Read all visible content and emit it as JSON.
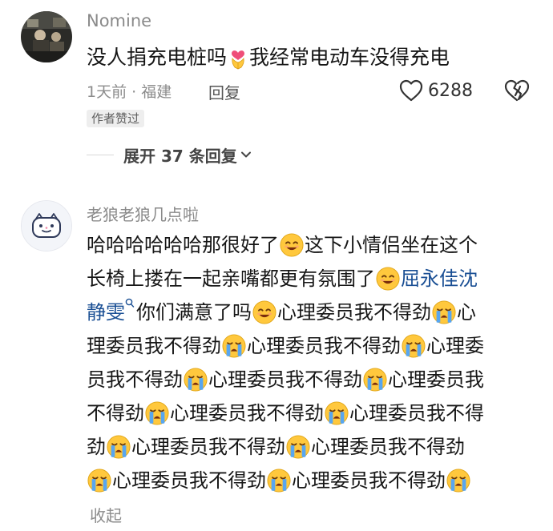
{
  "comments": [
    {
      "username": "Nomine",
      "text_before_emoji": "没人捐充电桩吗",
      "emoji": "heart-hands-emoji",
      "text_after_emoji": "我经常电动车没得充电",
      "meta": "1天前 · 福建",
      "reply_label": "回复",
      "like_count": "6288",
      "badge": "作者赞过",
      "expand_label": "展开 37 条回复"
    },
    {
      "username": "老狼老狼几点啦",
      "lines": [
        {
          "t1": "哈哈哈哈哈哈那很好了",
          "t2": "这下小情侣坐在这个"
        },
        {
          "t1": "长椅上搂在一起亲嘴都更有氛围了",
          "mention": "屈永佳沈"
        },
        {
          "mention": "静雯",
          "t1": "你们满意了吗",
          "t2": "心理委员我不得劲",
          "t3": "心"
        },
        {
          "t1": "理委员我不得劲",
          "t2": "心理委员我不得劲",
          "t3": "心理委"
        },
        {
          "t1": "员我不得劲",
          "t2": "心理委员我不得劲",
          "t3": "心理委员我"
        },
        {
          "t1": "不得劲",
          "t2": "心理委员我不得劲",
          "t3": "心理委员我不得"
        },
        {
          "t1": "劲",
          "t2": "心理委员我不得劲",
          "t3": "心理委员我不得劲"
        },
        {
          "t1": "心理委员我不得劲",
          "t2": "心理委员我不得劲"
        }
      ],
      "collapse_label": "收起"
    }
  ],
  "colors": {
    "mention": "#1a4f94",
    "meta": "#8c8c8c",
    "emoji_yellow": "#ffc83d",
    "emoji_tear": "#58a6f0"
  }
}
